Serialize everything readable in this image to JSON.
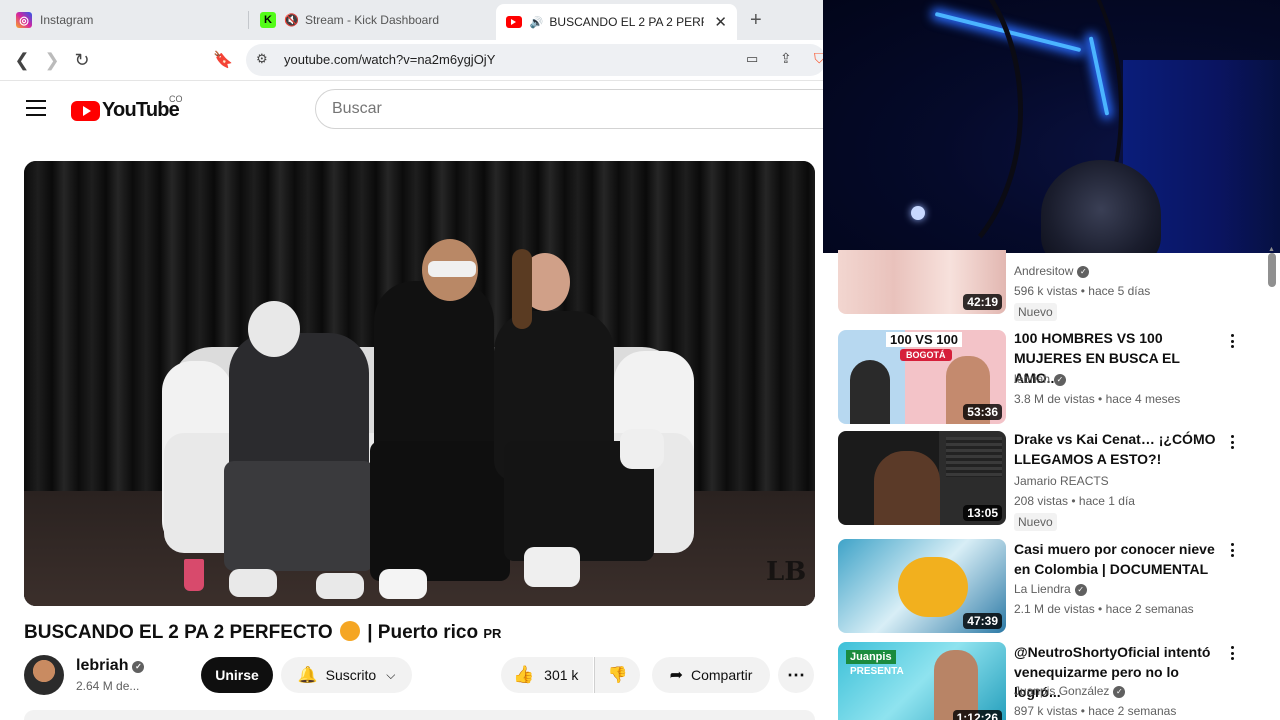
{
  "browser": {
    "tabs": [
      {
        "label": "Instagram",
        "icon": "instagram-icon",
        "color": "#d6249f"
      },
      {
        "label": "Stream - Kick Dashboard",
        "icon": "kick-icon",
        "color": "#53fc18"
      },
      {
        "label": "BUSCANDO EL 2 PA 2 PERFEC",
        "icon": "youtube-icon",
        "color": "#ff0000"
      }
    ],
    "new_tab": "+",
    "url": "youtube.com/watch?v=na2m6ygjOjY"
  },
  "header": {
    "logo_text": "YouTube",
    "country": "CO",
    "search_placeholder": "Buscar"
  },
  "video": {
    "title": "BUSCANDO EL 2 PA 2 PERFECTO",
    "title_suffix": "| Puerto rico",
    "title_flag": "PR",
    "watermark": "LB",
    "channel": "lebriah",
    "subscribers": "2.64 M de...",
    "join_label": "Unirse",
    "subscribed_label": "Suscrito",
    "likes": "301 k",
    "share_label": "Compartir"
  },
  "recommendations": [
    {
      "title": "",
      "channel": "Andresitow",
      "verified": true,
      "views": "596 k vistas",
      "age": "hace 5 días",
      "badge": "Nuevo",
      "duration": "42:19"
    },
    {
      "title": "100 HOMBRES VS 100 MUJERES EN BUSCA EL AMO...",
      "channel": "lebriah",
      "verified": true,
      "views": "3.8 M de vistas",
      "age": "hace 4 meses",
      "badge": "",
      "duration": "53:36",
      "thumb_text": "100 VS 100",
      "thumb_tag": "BOGOTÁ"
    },
    {
      "title": "Drake vs Kai Cenat… ¡¿CÓMO LLEGAMOS A ESTO?!",
      "channel": "Jamario REACTS",
      "verified": false,
      "views": "208 vistas",
      "age": "hace 1 día",
      "badge": "Nuevo",
      "duration": "13:05"
    },
    {
      "title": "Casi muero por conocer nieve en Colombia | DOCUMENTAL",
      "channel": "La Liendra",
      "verified": true,
      "views": "2.1 M de vistas",
      "age": "hace 2 semanas",
      "badge": "",
      "duration": "47:39"
    },
    {
      "title": "@NeutroShortyOficial intentó venequizarme pero no lo logró...",
      "channel": "Juanpis González",
      "verified": true,
      "views": "897 k vistas",
      "age": "hace 2 semanas",
      "badge": "",
      "duration": "1:12:26",
      "thumb_text": "Juanpis",
      "thumb_tag": "PRESENTA"
    }
  ],
  "separator": "•"
}
